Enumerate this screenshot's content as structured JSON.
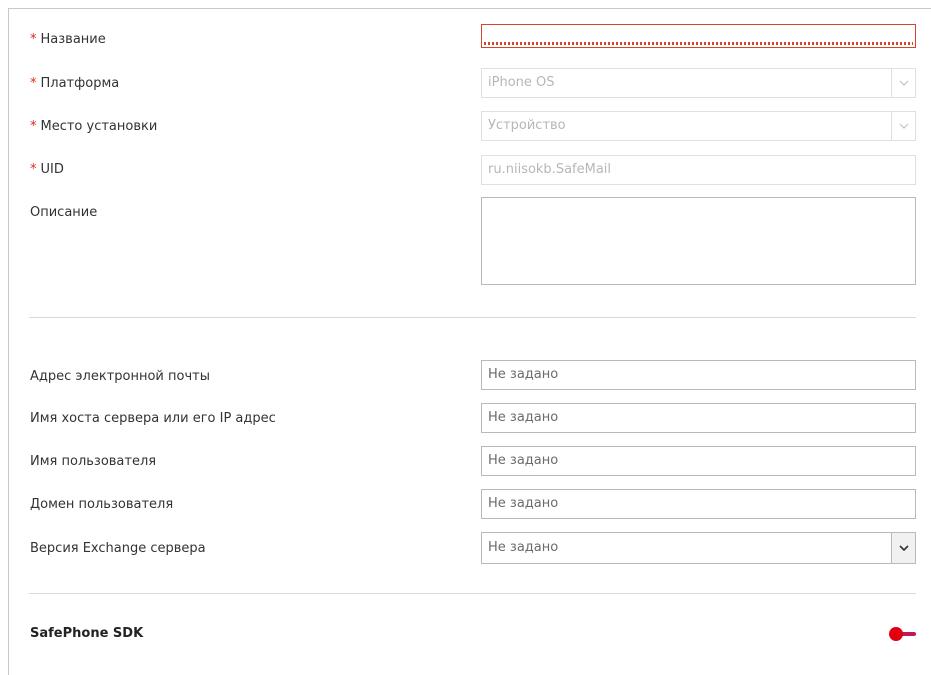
{
  "general": {
    "name": {
      "label": "Название",
      "required_mark": "*",
      "value": ""
    },
    "platform": {
      "label": "Платформа",
      "required_mark": "*",
      "value": "iPhone OS"
    },
    "install_location": {
      "label": "Место установки",
      "required_mark": "*",
      "value": "Устройство"
    },
    "uid": {
      "label": "UID",
      "required_mark": "*",
      "value": "ru.niisokb.SafeMail"
    },
    "description": {
      "label": "Описание",
      "value": ""
    }
  },
  "exchange": {
    "email": {
      "label": "Адрес электронной почты",
      "value": "Не задано"
    },
    "server_host": {
      "label": "Имя хоста сервера или его IP адрес",
      "value": "Не задано"
    },
    "username": {
      "label": "Имя пользователя",
      "value": "Не задано"
    },
    "user_domain": {
      "label": "Домен пользователя",
      "value": "Не задано"
    },
    "exchange_version": {
      "label": "Версия Exchange сервера",
      "value": "Не задано"
    }
  },
  "sdk": {
    "title": "SafePhone SDK",
    "enabled": false,
    "toggle_color": "#e0000f"
  },
  "icons": {
    "dropdown": "chevron-down-icon",
    "toggle": "toggle-switch-icon"
  },
  "colors": {
    "required": "#e0281c",
    "error_border": "#d6442c",
    "disabled_text": "#b7b7b7"
  }
}
